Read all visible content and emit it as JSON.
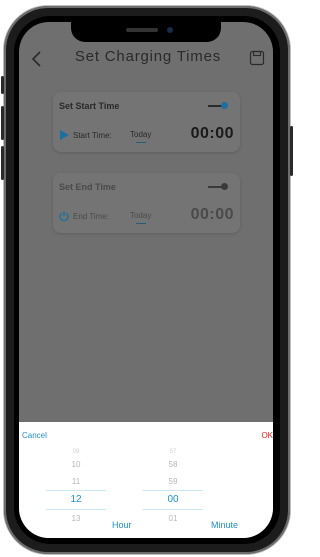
{
  "header": {
    "title": "Set Charging Times"
  },
  "start_card": {
    "title": "Set Start Time",
    "label": "Start Time:",
    "day": "Today",
    "time": "00:00",
    "enabled": true
  },
  "end_card": {
    "title": "Set End Time",
    "label": "End Time:",
    "day": "Today",
    "time": "00:00",
    "enabled": false
  },
  "picker": {
    "cancel_label": "Cancel",
    "ok_label": "OK",
    "hour_items": [
      "09",
      "10",
      "11",
      "12",
      "13"
    ],
    "hour_selected": "12",
    "hour_unit": "Hour",
    "minute_items": [
      "57",
      "58",
      "59",
      "00",
      "01"
    ],
    "minute_selected": "00",
    "minute_unit": "Minute"
  },
  "colors": {
    "accent_blue": "#1e8fd0",
    "ok_red": "#e52020",
    "overlay_grey": "#6f6f6f"
  }
}
